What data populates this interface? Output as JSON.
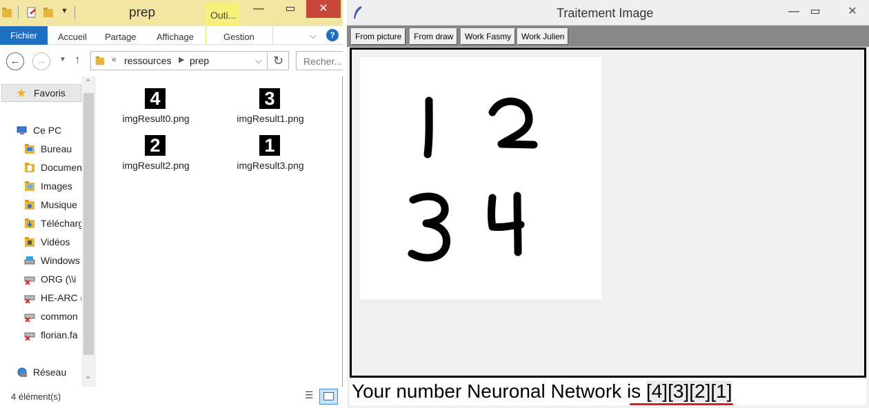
{
  "explorer": {
    "title": "prep",
    "contextual_tab": "Outi...",
    "ribbon_tabs": [
      "Fichier",
      "Accueil",
      "Partage",
      "Affichage",
      "Gestion"
    ],
    "breadcrumb": [
      "ressources",
      "prep"
    ],
    "search_placeholder": "Recher...",
    "nav": [
      {
        "label": "Favoris",
        "icon": "star-icon"
      },
      {
        "label": "Ce PC",
        "icon": "computer-icon"
      },
      {
        "label": "Bureau",
        "icon": "folder-icon"
      },
      {
        "label": "Documents",
        "icon": "folder-icon"
      },
      {
        "label": "Images",
        "icon": "folder-icon"
      },
      {
        "label": "Musique",
        "icon": "folder-icon"
      },
      {
        "label": "Téléchargements",
        "icon": "folder-icon"
      },
      {
        "label": "Vidéos",
        "icon": "folder-icon"
      },
      {
        "label": "Windows",
        "icon": "drive-icon"
      },
      {
        "label": "ORG (\\\\i",
        "icon": "network-drive-icon"
      },
      {
        "label": "HE-ARC (",
        "icon": "network-drive-icon"
      },
      {
        "label": "common",
        "icon": "network-drive-icon"
      },
      {
        "label": "florian.fa",
        "icon": "network-drive-icon"
      },
      {
        "label": "Réseau",
        "icon": "network-icon"
      }
    ],
    "files": [
      {
        "name": "imgResult0.png",
        "digit": "4"
      },
      {
        "name": "imgResult1.png",
        "digit": "3"
      },
      {
        "name": "imgResult2.png",
        "digit": "2"
      },
      {
        "name": "imgResult3.png",
        "digit": "1"
      }
    ],
    "status": "4 élément(s)"
  },
  "tk": {
    "title": "Traitement Image",
    "buttons": [
      "From picture",
      "From draw",
      "Work Fasmy",
      "Work Julien"
    ],
    "drawn_digits": [
      "1",
      "2",
      "3",
      "4"
    ],
    "result_prefix": "Your number Neuronal Network is ",
    "result_value": "[4][3][2][1]"
  },
  "colors": {
    "explorer_title_bg": "#f3e6a2",
    "fichier_blue": "#1e6fc2",
    "close_red": "#c7473a",
    "toolbar_gray": "#888888",
    "underline_red": "#dd1c1c"
  }
}
